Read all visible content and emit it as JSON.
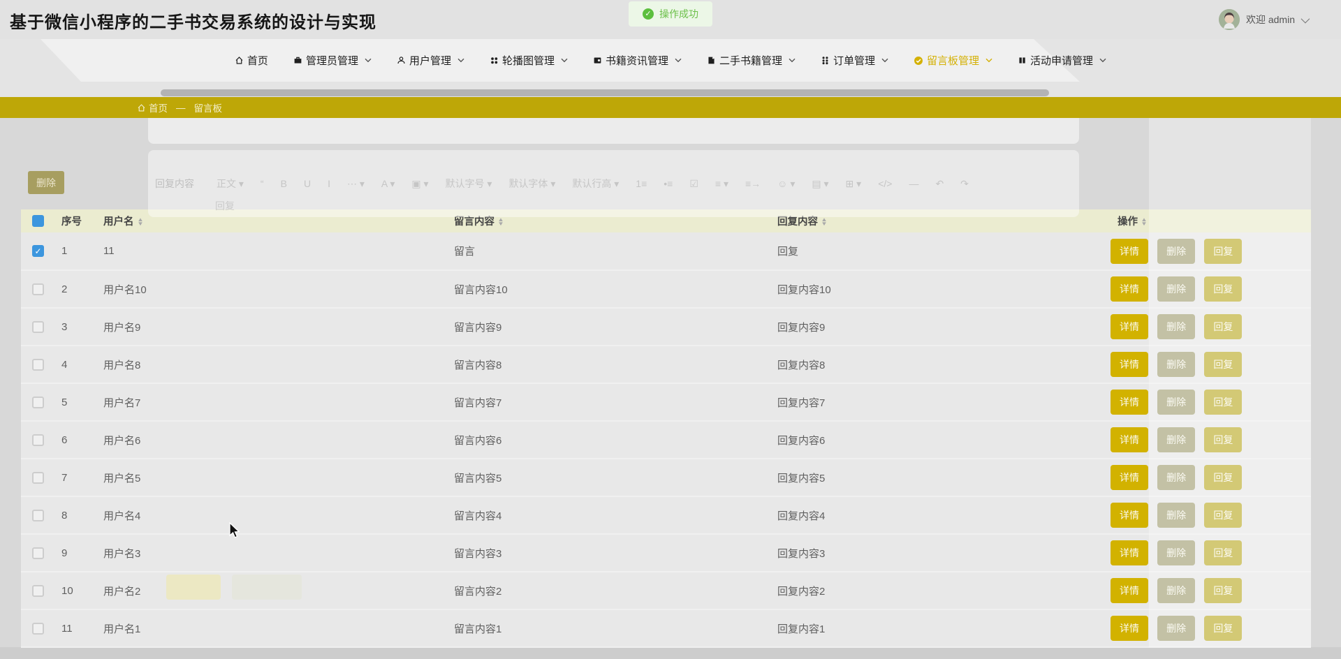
{
  "header": {
    "title": "基于微信小程序的二手书交易系统的设计与实现",
    "welcome": "欢迎 admin"
  },
  "toast": {
    "label": "操作成功"
  },
  "nav": {
    "items": [
      {
        "name": "nav-item-home",
        "label": "首页",
        "icon": "home-icon",
        "has_dropdown": false,
        "active": false
      },
      {
        "name": "nav-item-admin",
        "label": "管理员管理",
        "icon": "admin-icon",
        "has_dropdown": true,
        "active": false
      },
      {
        "name": "nav-item-user",
        "label": "用户管理",
        "icon": "user-icon",
        "has_dropdown": true,
        "active": false
      },
      {
        "name": "nav-item-carousel",
        "label": "轮播图管理",
        "icon": "carousel-icon",
        "has_dropdown": true,
        "active": false
      },
      {
        "name": "nav-item-booknews",
        "label": "书籍资讯管理",
        "icon": "news-icon",
        "has_dropdown": true,
        "active": false
      },
      {
        "name": "nav-item-usedbook",
        "label": "二手书籍管理",
        "icon": "book-icon",
        "has_dropdown": true,
        "active": false
      },
      {
        "name": "nav-item-order",
        "label": "订单管理",
        "icon": "order-icon",
        "has_dropdown": true,
        "active": false
      },
      {
        "name": "nav-item-message",
        "label": "留言板管理",
        "icon": "message-icon",
        "has_dropdown": true,
        "active": true
      },
      {
        "name": "nav-item-activity",
        "label": "活动申请管理",
        "icon": "activity-icon",
        "has_dropdown": true,
        "active": false
      }
    ]
  },
  "breadcrumb": {
    "home": "首页",
    "separator": "—",
    "current": "留言板"
  },
  "toolbar": {
    "bulk_delete_label": "删除"
  },
  "table": {
    "columns": [
      {
        "label": "序号",
        "sortable": false
      },
      {
        "label": "用户名",
        "sortable": true
      },
      {
        "label": "留言内容",
        "sortable": true
      },
      {
        "label": "回复内容",
        "sortable": true
      },
      {
        "label": "操作",
        "sortable": true
      }
    ],
    "action_labels": {
      "detail": "详情",
      "delete": "删除",
      "reply": "回复"
    },
    "rows": [
      {
        "index": "1",
        "username": "11",
        "message": "留言",
        "reply": "回复",
        "checked": true
      },
      {
        "index": "2",
        "username": "用户名10",
        "message": "留言内容10",
        "reply": "回复内容10",
        "checked": false
      },
      {
        "index": "3",
        "username": "用户名9",
        "message": "留言内容9",
        "reply": "回复内容9",
        "checked": false
      },
      {
        "index": "4",
        "username": "用户名8",
        "message": "留言内容8",
        "reply": "回复内容8",
        "checked": false
      },
      {
        "index": "5",
        "username": "用户名7",
        "message": "留言内容7",
        "reply": "回复内容7",
        "checked": false
      },
      {
        "index": "6",
        "username": "用户名6",
        "message": "留言内容6",
        "reply": "回复内容6",
        "checked": false
      },
      {
        "index": "7",
        "username": "用户名5",
        "message": "留言内容5",
        "reply": "回复内容5",
        "checked": false
      },
      {
        "index": "8",
        "username": "用户名4",
        "message": "留言内容4",
        "reply": "回复内容4",
        "checked": false
      },
      {
        "index": "9",
        "username": "用户名3",
        "message": "留言内容3",
        "reply": "回复内容3",
        "checked": false
      },
      {
        "index": "10",
        "username": "用户名2",
        "message": "留言内容2",
        "reply": "回复内容2",
        "checked": false
      },
      {
        "index": "11",
        "username": "用户名1",
        "message": "留言内容1",
        "reply": "回复内容1",
        "checked": false
      }
    ]
  },
  "ghost_dialog": {
    "editor_label": "回复内容",
    "editor_content": "回复",
    "toolbar_items": [
      "正文 ▾",
      "“",
      "B",
      "U",
      "I",
      "⋯ ▾",
      "A ▾",
      "▣ ▾",
      "默认字号 ▾",
      "默认字体 ▾",
      "默认行高 ▾",
      "1≡",
      "•≡",
      "☑",
      "≡ ▾",
      "≡→",
      "☺ ▾",
      "▤ ▾",
      "⊞ ▾",
      "</>",
      "—",
      "↶",
      "↷"
    ]
  },
  "colors": {
    "accent_yellow": "#d4b106",
    "breadcrumb_yellow": "#bea707",
    "header_row": "#ebecd0",
    "checkbox_blue": "#3c96de",
    "toast_green": "#6cc04a"
  }
}
